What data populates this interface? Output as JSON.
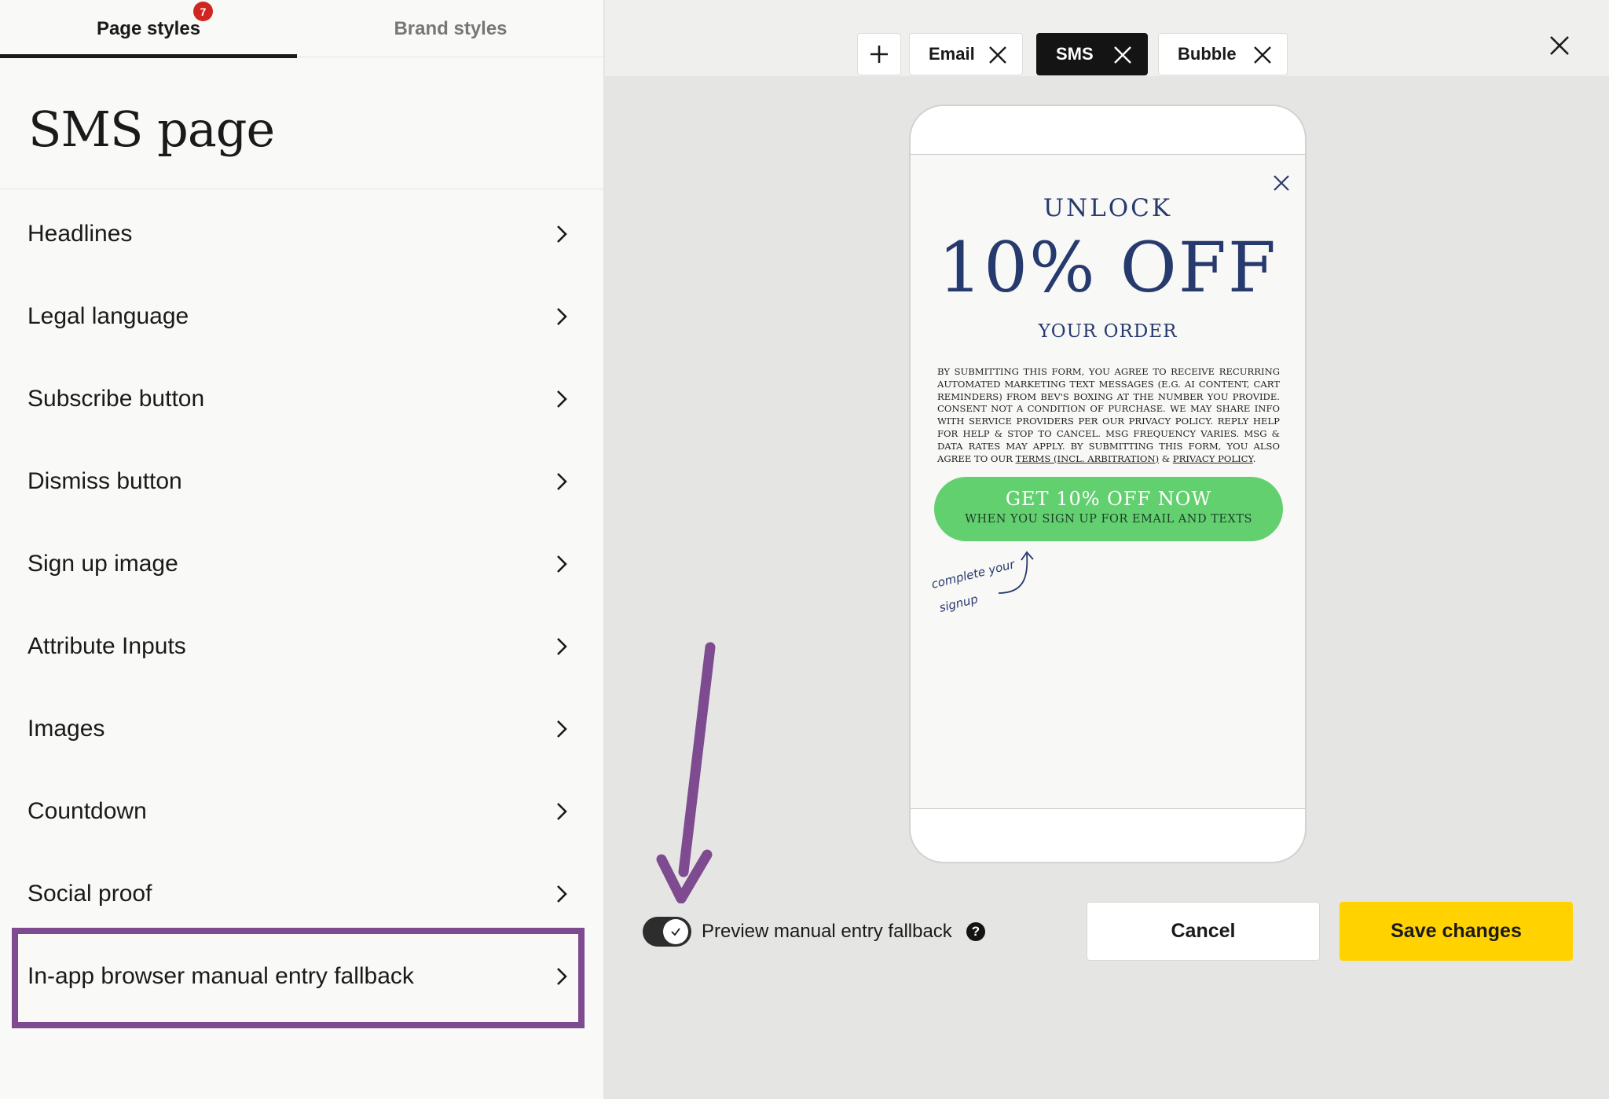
{
  "tabs": {
    "page_styles": "Page styles",
    "brand_styles": "Brand styles",
    "badge_count": "7"
  },
  "page": {
    "title": "SMS page"
  },
  "menu": [
    {
      "label": "Headlines"
    },
    {
      "label": "Legal language"
    },
    {
      "label": "Subscribe button"
    },
    {
      "label": "Dismiss button"
    },
    {
      "label": "Sign up image"
    },
    {
      "label": "Attribute Inputs"
    },
    {
      "label": "Images"
    },
    {
      "label": "Countdown"
    },
    {
      "label": "Social proof"
    },
    {
      "label": "In-app browser manual entry fallback"
    }
  ],
  "preview_tabs": [
    {
      "label": "Email",
      "active": false
    },
    {
      "label": "SMS",
      "active": true
    },
    {
      "label": "Bubble",
      "active": false
    }
  ],
  "popup": {
    "unlock": "UNLOCK",
    "offer": "10% OFF",
    "order": "YOUR ORDER",
    "legal_text": "By submitting this form, you agree to receive recurring automated marketing text messages (e.g. AI content, cart reminders) from Bev's Boxing at the number you provide. Consent not a condition of purchase. We may share info with service providers per our privacy policy. Reply HELP for help & STOP to cancel. Msg frequency varies. Msg & data rates may apply. By submitting this form, you also agree to our",
    "terms_link": "Terms (incl. arbitration)",
    "legal_and": "&",
    "privacy_link": "Privacy Policy",
    "cta_main": "GET 10% OFF NOW",
    "cta_sub": "WHEN YOU SIGN UP FOR EMAIL AND TEXTS",
    "handwritten_line1": "complete your",
    "handwritten_line2": "signup"
  },
  "footer": {
    "toggle_label": "Preview manual entry fallback",
    "toggle_on": true,
    "help": "?",
    "cancel": "Cancel",
    "save": "Save changes"
  },
  "colors": {
    "badge": "#d1251f",
    "highlight": "#7e4b91",
    "popup_navy": "#273a6e",
    "cta_green": "#63d070",
    "save_yellow": "#ffd200"
  }
}
